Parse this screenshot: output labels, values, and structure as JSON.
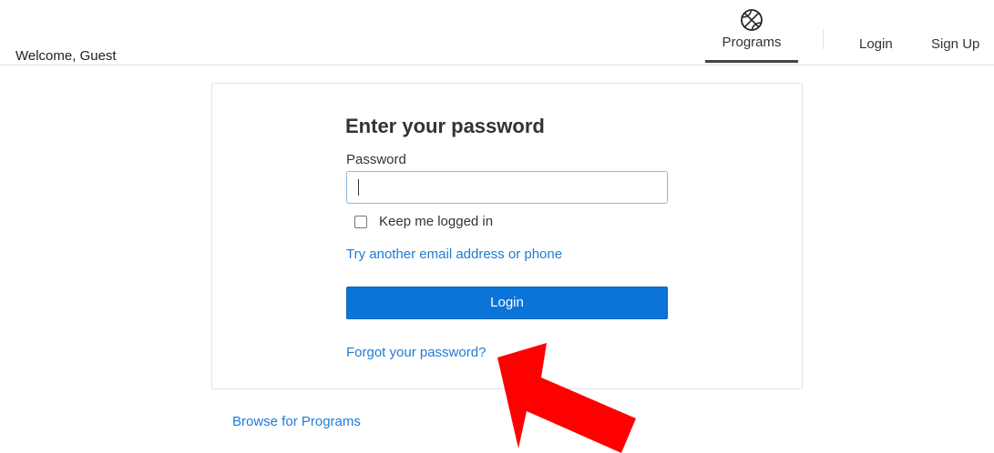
{
  "header": {
    "welcome": "Welcome, Guest",
    "nav": {
      "programs": "Programs",
      "programs_icon": "basketball-icon",
      "login": "Login",
      "signup": "Sign Up"
    }
  },
  "login_form": {
    "title": "Enter your password",
    "password_label": "Password",
    "password_value": "",
    "keep_logged_in_label": "Keep me logged in",
    "keep_logged_in_checked": false,
    "try_another_link": "Try another email address or phone",
    "login_button": "Login",
    "forgot_link": "Forgot your password?"
  },
  "browse_link": "Browse for Programs",
  "annotation": {
    "icon": "red-arrow-icon",
    "color": "#ff0000"
  },
  "colors": {
    "link": "#1f7bd6",
    "primary_button": "#0b74d8"
  }
}
